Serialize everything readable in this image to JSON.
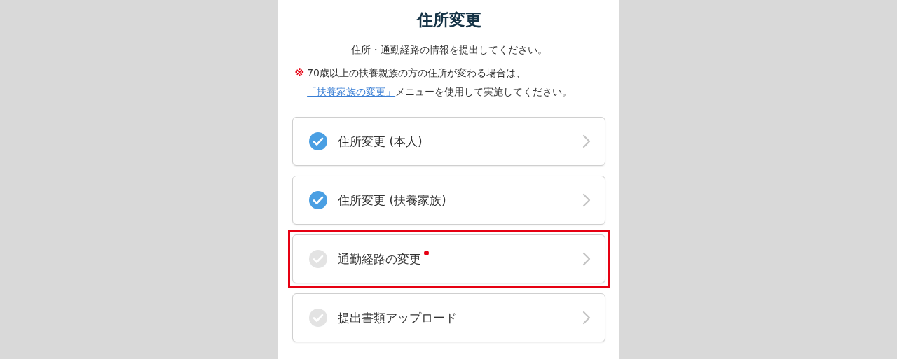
{
  "title": "住所変更",
  "intro": "住所・通勤経路の情報を提出してください。",
  "notice": {
    "mark": "※",
    "text_before": "70歳以上の扶養親族の方の住所が変わる場合は、",
    "link": "「扶養家族の変更」",
    "text_after": "メニューを使用して実施してください。"
  },
  "items": [
    {
      "label": "住所変更 (本人)",
      "completed": true,
      "alert": false,
      "highlighted": false
    },
    {
      "label": "住所変更 (扶養家族)",
      "completed": true,
      "alert": false,
      "highlighted": false
    },
    {
      "label": "通勤経路の変更",
      "completed": false,
      "alert": true,
      "highlighted": true
    },
    {
      "label": "提出書類アップロード",
      "completed": false,
      "alert": false,
      "highlighted": false
    }
  ]
}
